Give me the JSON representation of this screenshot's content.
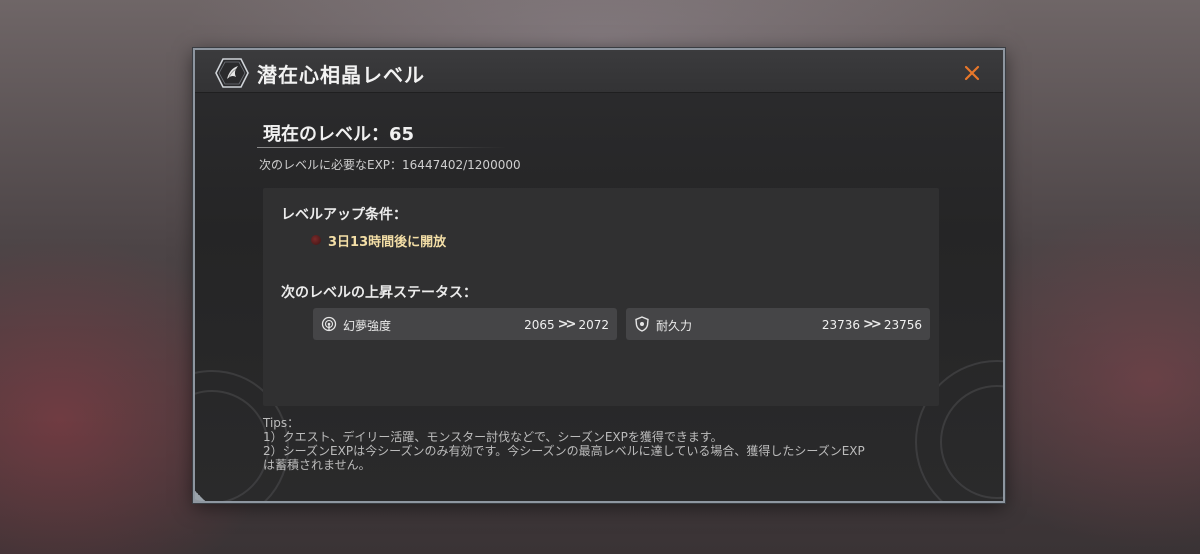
{
  "dialog": {
    "title": "潜在心相晶レベル"
  },
  "level": {
    "current": "現在のレベル：65",
    "exp_requirement": "次のレベルに必要なEXP：16447402/1200000"
  },
  "levelup": {
    "conditions_label": "レベルアップ条件：",
    "condition_text": "3日13時間後に開放"
  },
  "stats": {
    "section_label": "次のレベルの上昇ステータス：",
    "items": [
      {
        "name": "幻夢強度",
        "from": "2065",
        "to": "2072",
        "icon": "radar-icon"
      },
      {
        "name": "耐久力",
        "from": "23736",
        "to": "23756",
        "icon": "shield-icon"
      }
    ]
  },
  "tips": {
    "heading": "Tips：",
    "line1": "1）クエスト、デイリー活躍、モンスター討伐などで、シーズンEXPを獲得できます。",
    "line2": "2）シーズンEXPは今シーズンのみ有効です。今シーズンの最高レベルに達している場合、獲得したシーズンEXP",
    "line3": "は蓄積されません。"
  },
  "colors": {
    "close_accent": "#e8772a",
    "condition_text": "#f3dea6",
    "panel_bg": "#303031",
    "stat_box_bg": "#454547"
  }
}
